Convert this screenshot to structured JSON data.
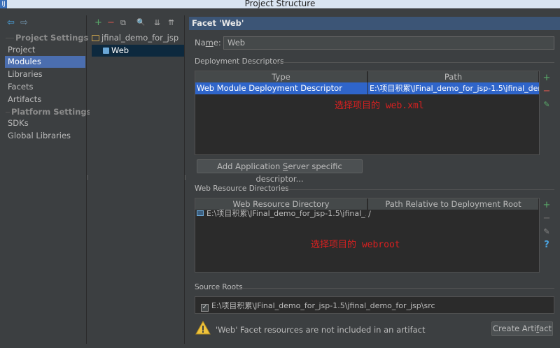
{
  "window": {
    "title": "Project Structure",
    "app_icon": "IJ"
  },
  "nav": {
    "back_icon": "arrow-left-icon",
    "forward_icon": "arrow-right-icon"
  },
  "sidebar": {
    "project_settings_header": "Project Settings",
    "platform_settings_header": "Platform Settings",
    "project_items": [
      "Project",
      "Modules",
      "Libraries",
      "Facets",
      "Artifacts"
    ],
    "platform_items": [
      "SDKs",
      "Global Libraries"
    ],
    "selected": "Modules"
  },
  "modules": {
    "toolbar": {
      "add": "+",
      "remove": "−",
      "copy": "⧉",
      "find": "🔍",
      "expand": "⇊",
      "collapse": "⇈"
    },
    "tree": [
      {
        "label": "jfinal_demo_for_jsp",
        "level": 0,
        "selected": false
      },
      {
        "label": "Web",
        "level": 1,
        "selected": true
      }
    ]
  },
  "facet": {
    "header": "Facet 'Web'",
    "name_label_prefix": "Na",
    "name_label_underlined": "m",
    "name_label_suffix": "e:",
    "name_value": "Web",
    "deployment": {
      "group_label": "Deployment Descriptors",
      "columns": [
        "Type",
        "Path"
      ],
      "rows": [
        {
          "type": "Web Module Deployment Descriptor",
          "path": "E:\\项目积累\\JFinal_demo_for_jsp-1.5\\jfinal_dem"
        }
      ],
      "annotation": "选择项目的 web.xml",
      "add_descriptor_button_prefix": "Add Application ",
      "add_descriptor_button_underlined": "S",
      "add_descriptor_button_suffix": "erver specific descriptor..."
    },
    "web_resources": {
      "group_label": "Web Resource Directories",
      "columns": [
        "Web Resource Directory",
        "Path Relative to Deployment Root"
      ],
      "rows": [
        {
          "directory": "E:\\项目积累\\JFinal_demo_for_jsp-1.5\\jfinal_...",
          "relative": "/"
        }
      ],
      "annotation": "选择项目的 webroot"
    },
    "source_roots": {
      "group_label": "Source Roots",
      "items": [
        {
          "checked": true,
          "path": "E:\\项目积累\\JFinal_demo_for_jsp-1.5\\jfinal_demo_for_jsp\\src"
        }
      ]
    },
    "warning": {
      "text": "'Web' Facet resources are not included in an artifact",
      "button_prefix": "Create Arti",
      "button_underlined": "f",
      "button_suffix": "act"
    }
  },
  "colors": {
    "accent": "#4b6eaf",
    "selection": "#2f65ca",
    "add": "#59a869",
    "remove": "#d9584f",
    "annotation": "#d92020"
  }
}
